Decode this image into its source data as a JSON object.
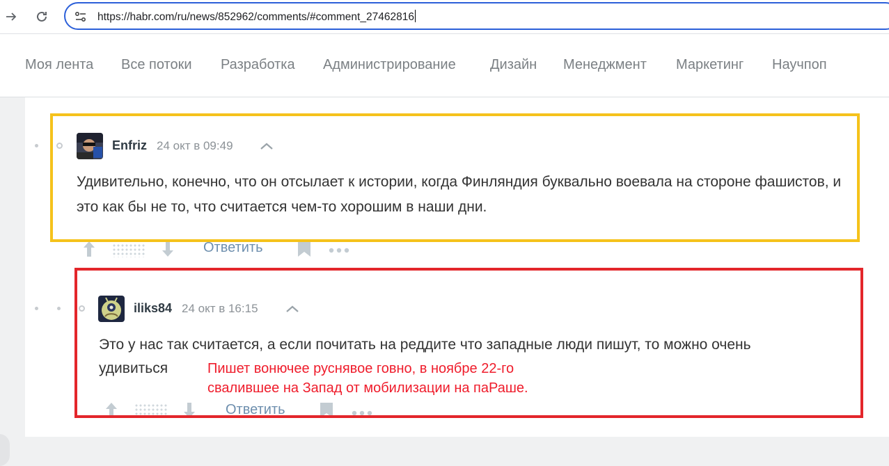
{
  "browser": {
    "url": "https://habr.com/ru/news/852962/comments/#comment_27462816"
  },
  "nav": {
    "items": [
      {
        "label": "Моя лента"
      },
      {
        "label": "Все потоки"
      },
      {
        "label": "Разработка"
      },
      {
        "label": "Администрирование"
      },
      {
        "label": "Дизайн"
      },
      {
        "label": "Менеджмент"
      },
      {
        "label": "Маркетинг"
      },
      {
        "label": "Научпоп"
      }
    ]
  },
  "comments": [
    {
      "username": "Enfriz",
      "timestamp": "24 окт в 09:49",
      "text": "Удивительно, конечно, что он отсылает к истории, когда Финляндия буквально воевала на стороне фашистов, и это как бы не то, что считается чем-то хорошим в наши дни.",
      "reply_label": "Ответить"
    },
    {
      "username": "iliks84",
      "timestamp": "24 окт в 16:15",
      "text_line1": "Это у нас так считается, а если почитать на реддите что западные люди пишут, то можно очень",
      "text_line2": "удивиться",
      "reply_label": "Ответить"
    }
  ],
  "annotation": {
    "line1": "Пишет вонючее руснявое говно, в ноябре 22-го",
    "line2": "свалившее на Запад от мобилизации на паРаше."
  },
  "colors": {
    "highlight_yellow": "#f5c21b",
    "highlight_red": "#e3262b",
    "annotation_text": "#ef1c2b",
    "reply_link": "#6e8fae"
  }
}
